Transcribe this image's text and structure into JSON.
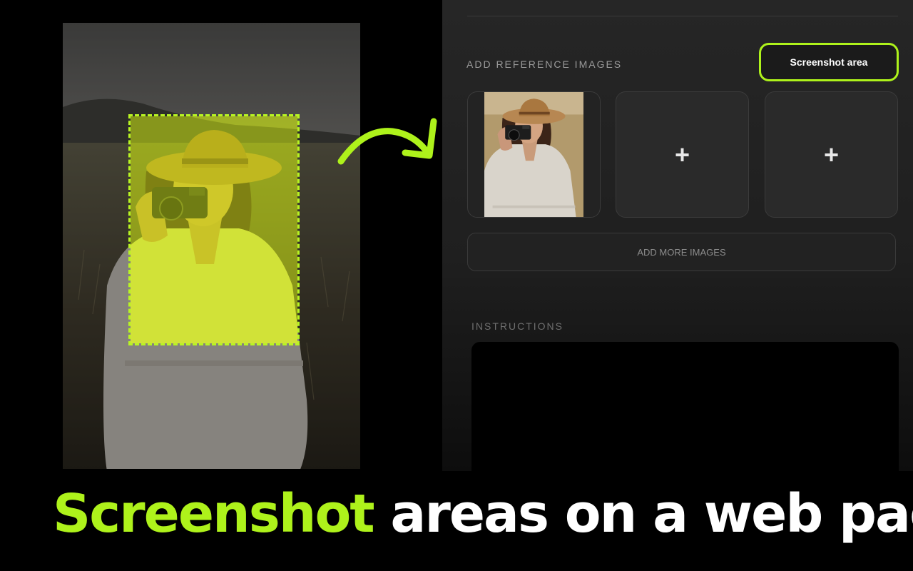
{
  "panel": {
    "reference_label": "ADD REFERENCE IMAGES",
    "screenshot_button": "Screenshot area",
    "slots": [
      {
        "type": "image",
        "icon": "portrait-thumbnail"
      },
      {
        "type": "empty",
        "icon": "plus-icon",
        "symbol": "+"
      },
      {
        "type": "empty",
        "icon": "plus-icon",
        "symbol": "+"
      }
    ],
    "add_more_label": "ADD MORE IMAGES",
    "instructions_label": "INSTRUCTIONS",
    "instructions_value": ""
  },
  "headline": {
    "accent": "Screenshot",
    "rest": "areas on a web page"
  },
  "colors": {
    "accent": "#aef21b",
    "selection_tint": "#e8ff00",
    "background": "#000000",
    "panel": "#262626"
  }
}
